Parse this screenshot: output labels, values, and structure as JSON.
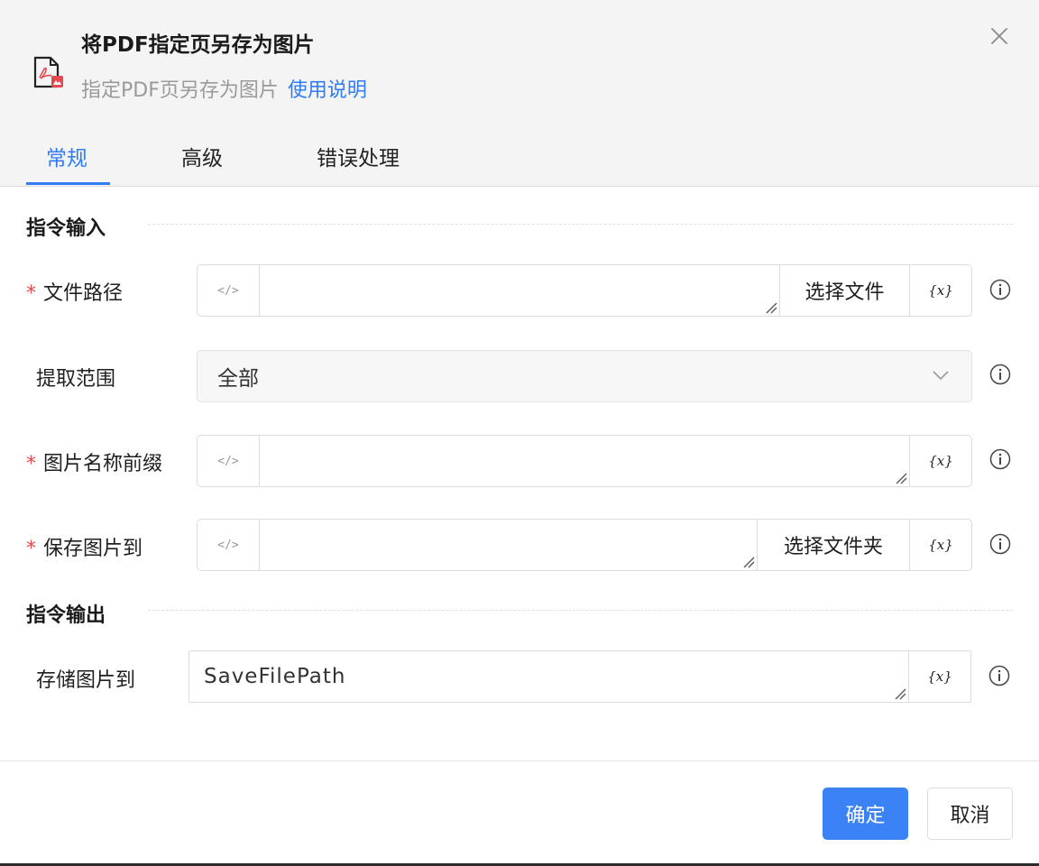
{
  "dialog": {
    "title": "将PDF指定页另存为图片",
    "subtitle": "指定PDF页另存为图片",
    "help_link": "使用说明"
  },
  "tabs": [
    {
      "label": "常规",
      "active": true
    },
    {
      "label": "高级",
      "active": false
    },
    {
      "label": "错误处理",
      "active": false
    }
  ],
  "sections": {
    "input_title": "指令输入",
    "output_title": "指令输出"
  },
  "fields": {
    "file_path": {
      "label": "文件路径",
      "required": true,
      "value": "",
      "button": "选择文件",
      "code_icon": "</>",
      "var_icon": "{x}"
    },
    "extract_range": {
      "label": "提取范围",
      "value": "全部"
    },
    "image_prefix": {
      "label": "图片名称前缀",
      "required": true,
      "value": "",
      "code_icon": "</>",
      "var_icon": "{x}"
    },
    "save_to": {
      "label": "保存图片到",
      "required": true,
      "value": "",
      "button": "选择文件夹",
      "code_icon": "</>",
      "var_icon": "{x}"
    },
    "store_path": {
      "label": "存储图片到",
      "value": "SaveFilePath",
      "var_icon": "{x}"
    }
  },
  "required_mark": "*",
  "footer": {
    "confirm": "确定",
    "cancel": "取消"
  },
  "colors": {
    "accent": "#2f7cf6",
    "primary_button": "#3b82f6",
    "required": "#e5484d",
    "header_bg": "#f4f4f5"
  },
  "icons": [
    "pdf-file-icon",
    "close-icon",
    "code-icon",
    "variable-icon",
    "resize-grip-icon",
    "chevron-down-icon",
    "info-icon"
  ]
}
